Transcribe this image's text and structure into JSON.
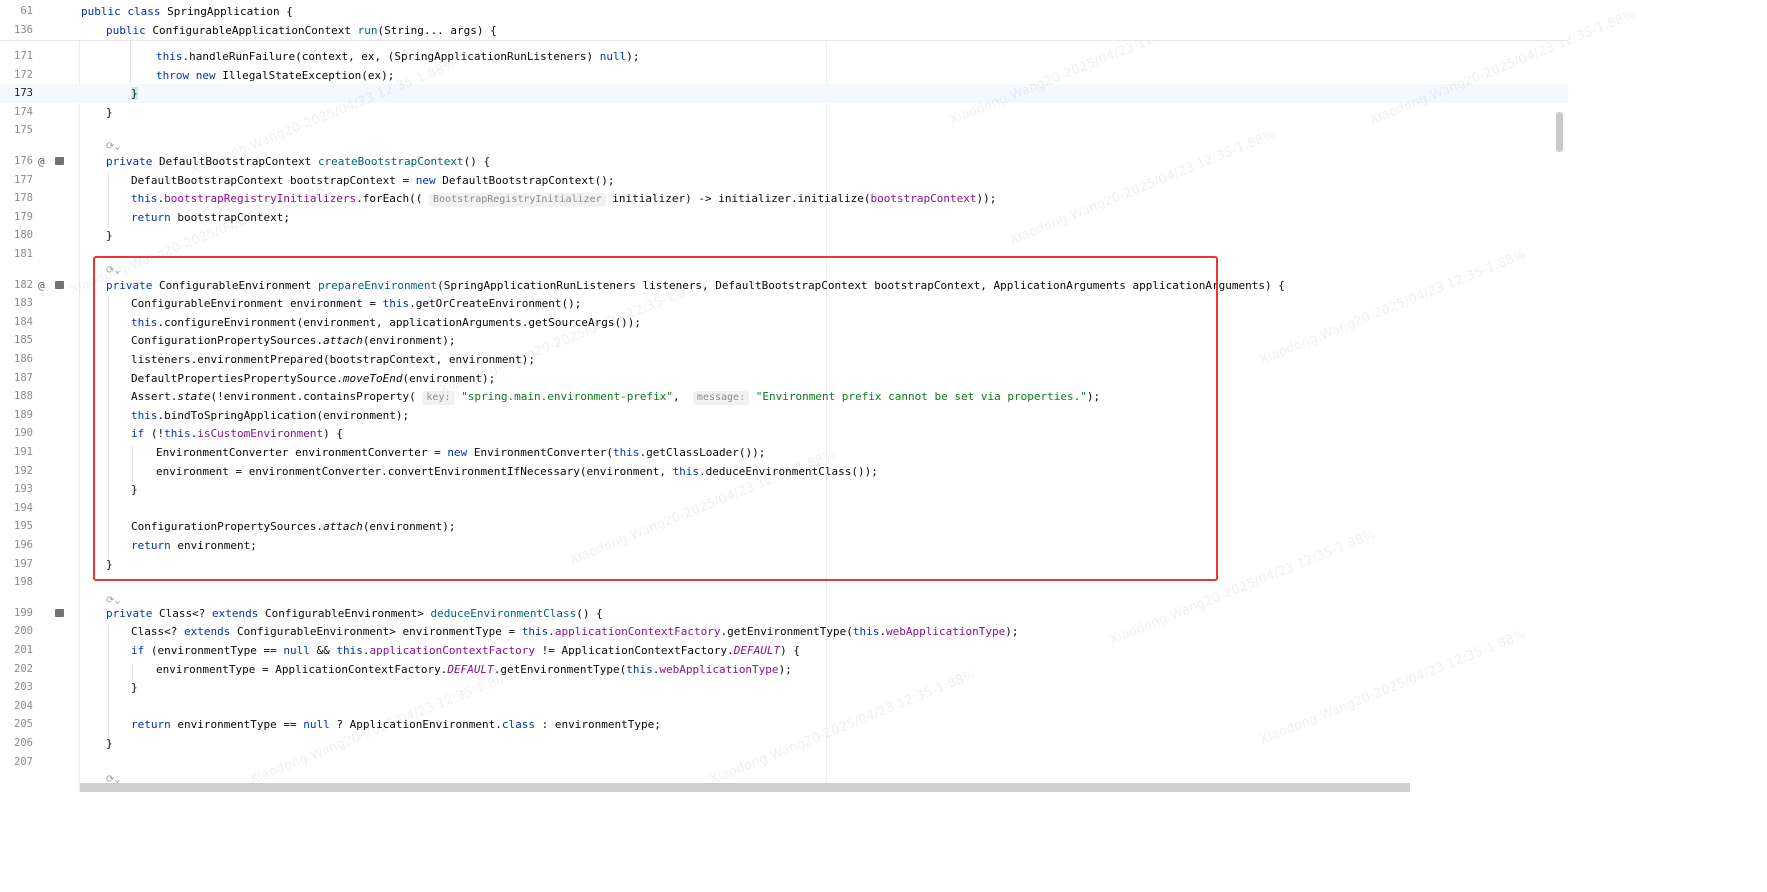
{
  "sticky_header": [
    {
      "num": "61",
      "code": [
        [
          "kw",
          "public class "
        ],
        [
          "",
          "SpringApplication {"
        ]
      ]
    },
    {
      "num": "136",
      "code": [
        [
          "kw",
          "public "
        ],
        [
          "",
          "ConfigurableApplicationContext "
        ],
        [
          "fn",
          "run"
        ],
        [
          "",
          "(String... args) {"
        ]
      ]
    }
  ],
  "lines": [
    {
      "num": "171",
      "code": [
        [
          "kw",
          "this"
        ],
        [
          "",
          ".handleRunFailure(context, ex, (SpringApplicationRunListeners) "
        ],
        [
          "kw",
          "null"
        ],
        [
          "",
          ");"
        ]
      ]
    },
    {
      "num": "172",
      "code": [
        [
          "kw",
          "throw new "
        ],
        [
          "",
          "IllegalStateException(ex);"
        ]
      ]
    },
    {
      "num": "173",
      "code": [
        [
          "brace",
          "}"
        ]
      ]
    },
    {
      "num": "174",
      "code": [
        [
          "",
          "}"
        ]
      ]
    },
    {
      "num": "175",
      "code": []
    },
    {
      "num": "176",
      "code": [
        [
          "kw",
          "private "
        ],
        [
          "",
          "DefaultBootstrapContext "
        ],
        [
          "fn",
          "createBootstrapContext"
        ],
        [
          "",
          "() {"
        ]
      ]
    },
    {
      "num": "177",
      "code": [
        [
          "",
          "DefaultBootstrapContext bootstrapContext = "
        ],
        [
          "kw",
          "new "
        ],
        [
          "",
          "DefaultBootstrapContext();"
        ]
      ]
    },
    {
      "num": "178",
      "code": [
        [
          "kw",
          "this"
        ],
        [
          "",
          "."
        ],
        [
          "fld",
          "bootstrapRegistryInitializers"
        ],
        [
          "",
          ".forEach(( "
        ],
        [
          "hint",
          "BootstrapRegistryInitializer"
        ],
        [
          "",
          " initializer) -> initializer.initialize("
        ],
        [
          "fld",
          "bootstrapContext"
        ],
        [
          "",
          "));"
        ]
      ]
    },
    {
      "num": "179",
      "code": [
        [
          "kw",
          "return "
        ],
        [
          "",
          "bootstrapContext;"
        ]
      ]
    },
    {
      "num": "180",
      "code": [
        [
          "",
          "}"
        ]
      ]
    },
    {
      "num": "181",
      "code": []
    },
    {
      "num": "182",
      "code": [
        [
          "kw",
          "private "
        ],
        [
          "",
          "ConfigurableEnvironment "
        ],
        [
          "fn",
          "prepareEnvironment"
        ],
        [
          "",
          "(SpringApplicationRunListeners listeners, DefaultBootstrapContext bootstrapContext, ApplicationArguments applicationArguments) {"
        ]
      ]
    },
    {
      "num": "183",
      "code": [
        [
          "",
          "ConfigurableEnvironment environment = "
        ],
        [
          "kw",
          "this"
        ],
        [
          "",
          ".getOrCreateEnvironment();"
        ]
      ]
    },
    {
      "num": "184",
      "code": [
        [
          "kw",
          "this"
        ],
        [
          "",
          ".configureEnvironment(environment, applicationArguments.getSourceArgs());"
        ]
      ]
    },
    {
      "num": "185",
      "code": [
        [
          "",
          "ConfigurationPropertySources."
        ],
        [
          "it",
          "attach"
        ],
        [
          "",
          "(environment);"
        ]
      ]
    },
    {
      "num": "186",
      "code": [
        [
          "",
          "listeners.environmentPrepared(bootstrapContext, environment);"
        ]
      ]
    },
    {
      "num": "187",
      "code": [
        [
          "",
          "DefaultPropertiesPropertySource."
        ],
        [
          "it",
          "moveToEnd"
        ],
        [
          "",
          "(environment);"
        ]
      ]
    },
    {
      "num": "188",
      "code": [
        [
          "",
          "Assert."
        ],
        [
          "it",
          "state"
        ],
        [
          "",
          "(!environment.containsProperty( "
        ],
        [
          "hint",
          "key:"
        ],
        [
          "",
          " "
        ],
        [
          "str",
          "\"spring.main.environment-prefix\""
        ],
        [
          "",
          ",  "
        ],
        [
          "hint",
          "message:"
        ],
        [
          "",
          " "
        ],
        [
          "str",
          "\"Environment prefix cannot be set via properties.\""
        ],
        [
          "",
          ");"
        ]
      ]
    },
    {
      "num": "189",
      "code": [
        [
          "kw",
          "this"
        ],
        [
          "",
          ".bindToSpringApplication(environment);"
        ]
      ]
    },
    {
      "num": "190",
      "code": [
        [
          "kw",
          "if "
        ],
        [
          "",
          "(!"
        ],
        [
          "kw",
          "this"
        ],
        [
          "",
          "."
        ],
        [
          "fld",
          "isCustomEnvironment"
        ],
        [
          "",
          ") {"
        ]
      ]
    },
    {
      "num": "191",
      "code": [
        [
          "",
          "EnvironmentConverter environmentConverter = "
        ],
        [
          "kw",
          "new "
        ],
        [
          "",
          "EnvironmentConverter("
        ],
        [
          "kw",
          "this"
        ],
        [
          "",
          ".getClassLoader());"
        ]
      ]
    },
    {
      "num": "192",
      "code": [
        [
          "",
          "environment = environmentConverter.convertEnvironmentIfNecessary(environment, "
        ],
        [
          "kw",
          "this"
        ],
        [
          "",
          ".deduceEnvironmentClass());"
        ]
      ]
    },
    {
      "num": "193",
      "code": [
        [
          "",
          "}"
        ]
      ]
    },
    {
      "num": "194",
      "code": []
    },
    {
      "num": "195",
      "code": [
        [
          "",
          "ConfigurationPropertySources."
        ],
        [
          "it",
          "attach"
        ],
        [
          "",
          "(environment);"
        ]
      ]
    },
    {
      "num": "196",
      "code": [
        [
          "kw",
          "return "
        ],
        [
          "",
          "environment;"
        ]
      ]
    },
    {
      "num": "197",
      "code": [
        [
          "",
          "}"
        ]
      ]
    },
    {
      "num": "198",
      "code": []
    },
    {
      "num": "199",
      "code": [
        [
          "kw",
          "private "
        ],
        [
          "",
          "Class<? "
        ],
        [
          "kw",
          "extends "
        ],
        [
          "",
          "ConfigurableEnvironment> "
        ],
        [
          "fn",
          "deduceEnvironmentClass"
        ],
        [
          "",
          "() {"
        ]
      ]
    },
    {
      "num": "200",
      "code": [
        [
          "",
          "Class<? "
        ],
        [
          "kw",
          "extends "
        ],
        [
          "",
          "ConfigurableEnvironment> environmentType = "
        ],
        [
          "kw",
          "this"
        ],
        [
          "",
          "."
        ],
        [
          "fld",
          "applicationContextFactory"
        ],
        [
          "",
          ".getEnvironmentType("
        ],
        [
          "kw",
          "this"
        ],
        [
          "",
          "."
        ],
        [
          "fld",
          "webApplicationType"
        ],
        [
          "",
          ");"
        ]
      ]
    },
    {
      "num": "201",
      "code": [
        [
          "kw",
          "if "
        ],
        [
          "",
          "(environmentType == "
        ],
        [
          "kw",
          "null"
        ],
        [
          "",
          " && "
        ],
        [
          "kw",
          "this"
        ],
        [
          "",
          "."
        ],
        [
          "fld",
          "applicationContextFactory"
        ],
        [
          "",
          " != ApplicationContextFactory."
        ],
        [
          "itf",
          "DEFAULT"
        ],
        [
          "",
          ") {"
        ]
      ]
    },
    {
      "num": "202",
      "code": [
        [
          "",
          "environmentType = ApplicationContextFactory."
        ],
        [
          "itf",
          "DEFAULT"
        ],
        [
          "",
          ".getEnvironmentType("
        ],
        [
          "kw",
          "this"
        ],
        [
          "",
          "."
        ],
        [
          "fld",
          "webApplicationType"
        ],
        [
          "",
          ");"
        ]
      ]
    },
    {
      "num": "203",
      "code": [
        [
          "",
          "}"
        ]
      ]
    },
    {
      "num": "204",
      "code": []
    },
    {
      "num": "205",
      "code": [
        [
          "kw",
          "return "
        ],
        [
          "",
          "environmentType == "
        ],
        [
          "kw",
          "null "
        ],
        [
          "",
          "? ApplicationEnvironment."
        ],
        [
          "kw",
          "class "
        ],
        [
          "",
          ": environmentType;"
        ]
      ]
    },
    {
      "num": "206",
      "code": [
        [
          "",
          "}"
        ]
      ]
    },
    {
      "num": "207",
      "code": []
    }
  ],
  "watermark_text": "Xiaodong.Wang20-2025/04/23  12:35-1.88%"
}
